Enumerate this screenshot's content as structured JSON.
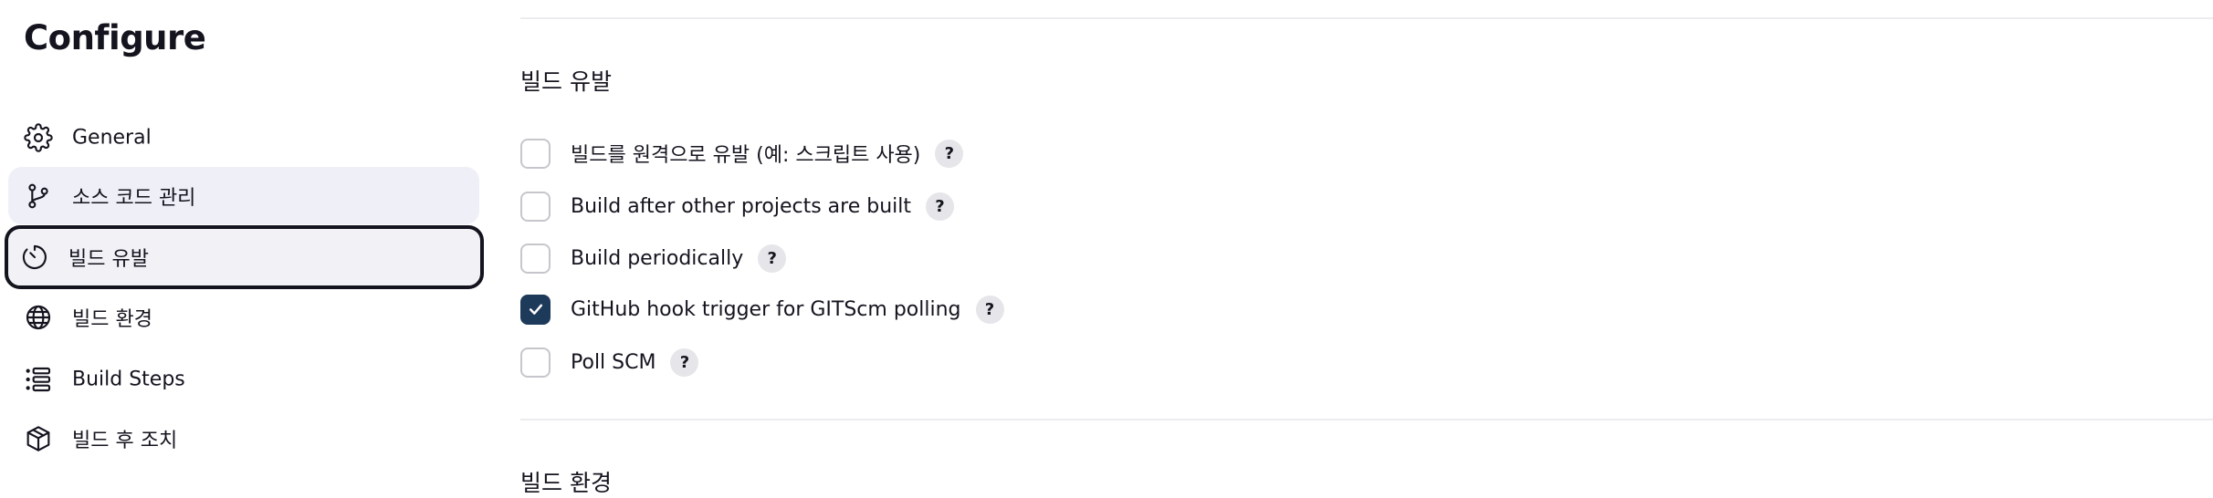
{
  "page": {
    "title": "Configure"
  },
  "sidebar": {
    "items": [
      {
        "label": "General",
        "icon": "gear-icon"
      },
      {
        "label": "소스 코드 관리",
        "icon": "source-branch-icon"
      },
      {
        "label": "빌드 유발",
        "icon": "timer-icon"
      },
      {
        "label": "빌드 환경",
        "icon": "globe-icon"
      },
      {
        "label": "Build Steps",
        "icon": "list-steps-icon"
      },
      {
        "label": "빌드 후 조치",
        "icon": "package-icon"
      }
    ]
  },
  "main": {
    "trigger_section": {
      "title": "빌드 유발",
      "options": [
        {
          "label": "빌드를 원격으로 유발 (예: 스크립트 사용)",
          "checked": false,
          "help": "?"
        },
        {
          "label": "Build after other projects are built",
          "checked": false,
          "help": "?"
        },
        {
          "label": "Build periodically",
          "checked": false,
          "help": "?"
        },
        {
          "label": "GitHub hook trigger for GITScm polling",
          "checked": true,
          "help": "?"
        },
        {
          "label": "Poll SCM",
          "checked": false,
          "help": "?"
        }
      ]
    },
    "env_section": {
      "title": "빌드 환경"
    }
  },
  "colors": {
    "accent_checked": "#1e3a5a",
    "sidebar_active_bg": "#f1f1f6",
    "text": "#14141f"
  }
}
